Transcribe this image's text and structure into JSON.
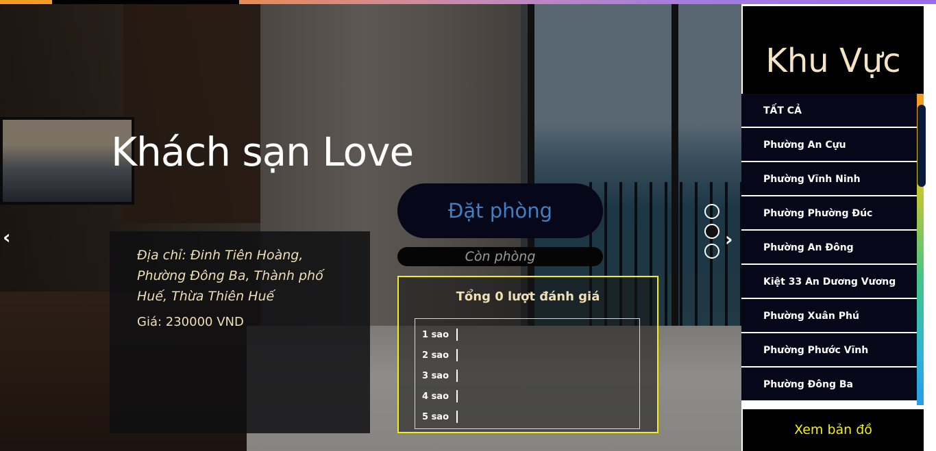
{
  "hotel": {
    "name": "Khách sạn Love",
    "address": "Địa chỉ: Đinh Tiên Hoàng, Phường Đông Ba, Thành phố Huế, Thừa Thiên Huế",
    "price": "Giá: 230000 VND",
    "book_label": "Đặt phòng",
    "status": "Còn phòng"
  },
  "carousel": {
    "prev": "‹",
    "next": "›",
    "active_slide": 2,
    "slide_count": 3
  },
  "reviews": {
    "title": "Tổng 0  lượt đánh giá",
    "rows": [
      "1 sao",
      "2 sao",
      "3 sao",
      "4 sao",
      "5 sao"
    ]
  },
  "sidebar": {
    "title": "Khu Vực",
    "items": [
      "TẤT CẢ",
      "Phường An Cựu",
      "Phường Vĩnh Ninh",
      "Phường Phường Đúc",
      "Phường An Đông",
      "Kiệt 33 An Dương Vương",
      "Phường Xuân Phú",
      "Phường Phước Vĩnh",
      "Phường Đông Ba"
    ],
    "map_button": "Xem bản đồ"
  },
  "colors": {
    "accent_yellow": "#f4f016",
    "cream_text": "#f0dfb6",
    "book_text": "#3f7fc4",
    "dark_navy": "#07071a"
  }
}
